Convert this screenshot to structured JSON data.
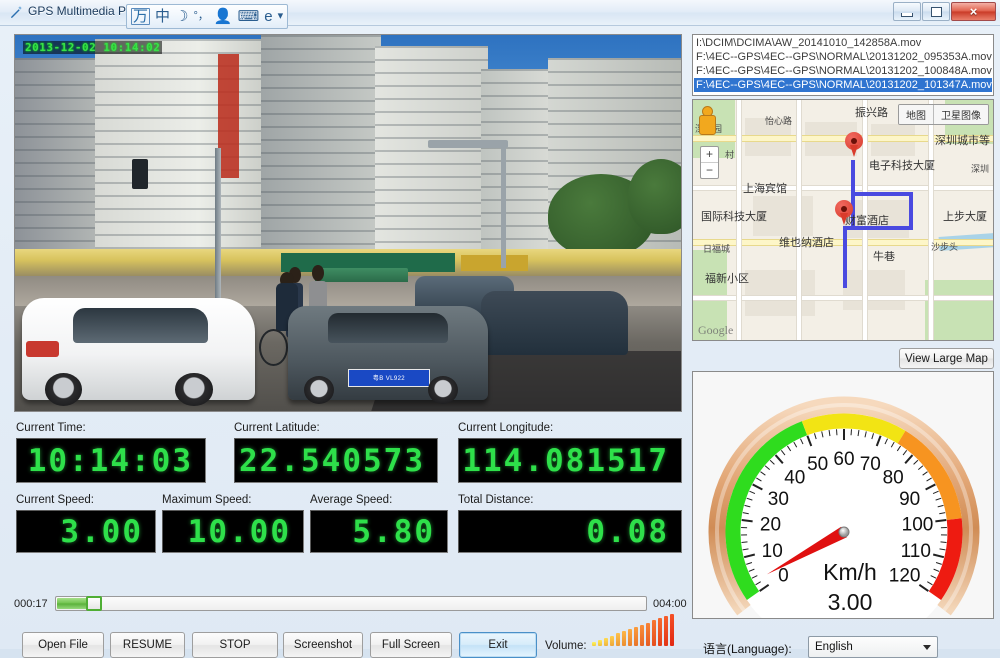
{
  "window": {
    "title": "GPS Multimedia Player",
    "icon": "pen-icon",
    "controls": {
      "minimize": "minimize-icon",
      "maximize": "maximize-icon",
      "close": "×"
    }
  },
  "ime_toolbar": {
    "items": [
      "万",
      "中",
      "☽",
      "°，",
      "👤",
      "⌨",
      "e",
      "▾"
    ]
  },
  "video": {
    "overlay_timestamp": "2013-12-02 10:14:02"
  },
  "readouts": {
    "current_time": {
      "label": "Current Time:",
      "value": "10:14:03"
    },
    "current_latitude": {
      "label": "Current Latitude:",
      "value": "22.540573"
    },
    "current_longitude": {
      "label": "Current Longitude:",
      "value": "114.081517"
    },
    "current_speed": {
      "label": "Current Speed:",
      "value": "3.00"
    },
    "maximum_speed": {
      "label": "Maximum Speed:",
      "value": "10.00"
    },
    "average_speed": {
      "label": "Average Speed:",
      "value": "5.80"
    },
    "total_distance": {
      "label": "Total Distance:",
      "value": "0.08"
    }
  },
  "transport": {
    "elapsed": "000:17",
    "duration": "004:00",
    "progress_percent": 7,
    "buttons": [
      {
        "label": "Open File",
        "name": "open-file-button",
        "focused": false
      },
      {
        "label": "RESUME",
        "name": "resume-button",
        "focused": false
      },
      {
        "label": "STOP",
        "name": "stop-button",
        "focused": false
      },
      {
        "label": "Screenshot",
        "name": "screenshot-button",
        "focused": false
      },
      {
        "label": "Full Screen",
        "name": "full-screen-button",
        "focused": false
      },
      {
        "label": "Exit",
        "name": "exit-button",
        "focused": true
      }
    ],
    "volume_label": "Volume:",
    "volume_bars": 14
  },
  "file_list": {
    "items": [
      {
        "path": "I:\\DCIM\\DCIMA\\AW_20141010_142858A.mov",
        "selected": false
      },
      {
        "path": "F:\\4EC--GPS\\4EC--GPS\\NORMAL\\20131202_095353A.mov",
        "selected": false
      },
      {
        "path": "F:\\4EC--GPS\\4EC--GPS\\NORMAL\\20131202_100848A.mov",
        "selected": false
      },
      {
        "path": "F:\\4EC--GPS\\4EC--GPS\\NORMAL\\20131202_101347A.mov",
        "selected": true
      }
    ]
  },
  "map": {
    "toggle": {
      "map_label": "地图",
      "satellite_label": "卫星图像"
    },
    "zoom_in": "+",
    "zoom_out": "−",
    "attribution": "Google",
    "view_large_map_label": "View Large Map",
    "labels": [
      "振兴路",
      "深圳城市等",
      "电子科技大厦",
      "上海宾馆",
      "国际科技大厦",
      "财富酒店",
      "维也纳酒店",
      "牛巷",
      "福新小区",
      "上步大厦",
      "深圳",
      "日福城",
      "沙步头",
      "怡心路",
      "村",
      "深圳园"
    ]
  },
  "gauge": {
    "unit": "Km/h",
    "value": "3.00",
    "min": 0,
    "max": 120,
    "tick_step": 10,
    "tick_labels": [
      "0",
      "10",
      "20",
      "30",
      "40",
      "50",
      "60",
      "70",
      "80",
      "90",
      "100",
      "110",
      "120"
    ],
    "zones": [
      {
        "from": 0,
        "to": 50,
        "color": "#2fdc1e"
      },
      {
        "from": 50,
        "to": 75,
        "color": "#f2e414"
      },
      {
        "from": 75,
        "to": 100,
        "color": "#f79420"
      },
      {
        "from": 100,
        "to": 120,
        "color": "#ee1b11"
      }
    ],
    "needle_color": "#e01010"
  },
  "language": {
    "label": "语言(Language):",
    "selected": "English"
  },
  "colors": {
    "lcd_green": "#2ee04a",
    "lcd_bg": "#000000",
    "selection_blue": "#2f74d0",
    "accent": "#4a90c8"
  }
}
